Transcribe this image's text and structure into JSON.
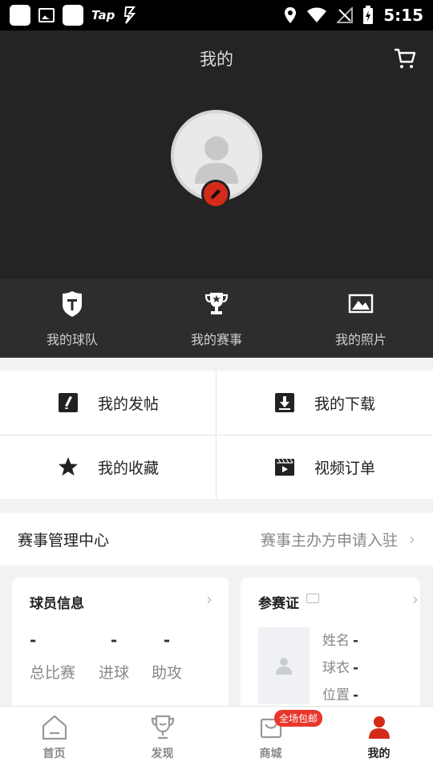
{
  "status_bar": {
    "carrier_tag": "Tap",
    "time": "5:15"
  },
  "header": {
    "title": "我的"
  },
  "quick_row": [
    {
      "label": "我的球队",
      "icon": "team-shield-icon"
    },
    {
      "label": "我的赛事",
      "icon": "trophy-icon"
    },
    {
      "label": "我的照片",
      "icon": "photo-icon"
    }
  ],
  "menu": [
    {
      "label": "我的发帖",
      "icon": "edit-post-icon"
    },
    {
      "label": "我的下载",
      "icon": "download-icon"
    },
    {
      "label": "我的收藏",
      "icon": "star-icon"
    },
    {
      "label": "视频订单",
      "icon": "video-order-icon"
    }
  ],
  "event_management": {
    "title": "赛事管理中心",
    "action": "赛事主办方申请入驻"
  },
  "player_card": {
    "title": "球员信息",
    "stats": [
      {
        "name": "总比赛",
        "value": "-"
      },
      {
        "name": "进球",
        "value": "-"
      },
      {
        "name": "助攻",
        "value": "-"
      }
    ]
  },
  "cert_card": {
    "title": "参赛证",
    "fields": [
      {
        "label": "姓名",
        "value": "-"
      },
      {
        "label": "球衣",
        "value": "-"
      },
      {
        "label": "位置",
        "value": "-"
      }
    ]
  },
  "bottom_nav": [
    {
      "label": "首页",
      "icon": "home-icon"
    },
    {
      "label": "发现",
      "icon": "discover-trophy-icon"
    },
    {
      "label": "商城",
      "icon": "shop-bag-icon",
      "badge": "全场包邮"
    },
    {
      "label": "我的",
      "icon": "profile-icon",
      "active": true
    }
  ],
  "colors": {
    "accent_red": "#d42a1a",
    "header_bg": "#242424",
    "quick_row_bg": "#2d2d2d"
  }
}
